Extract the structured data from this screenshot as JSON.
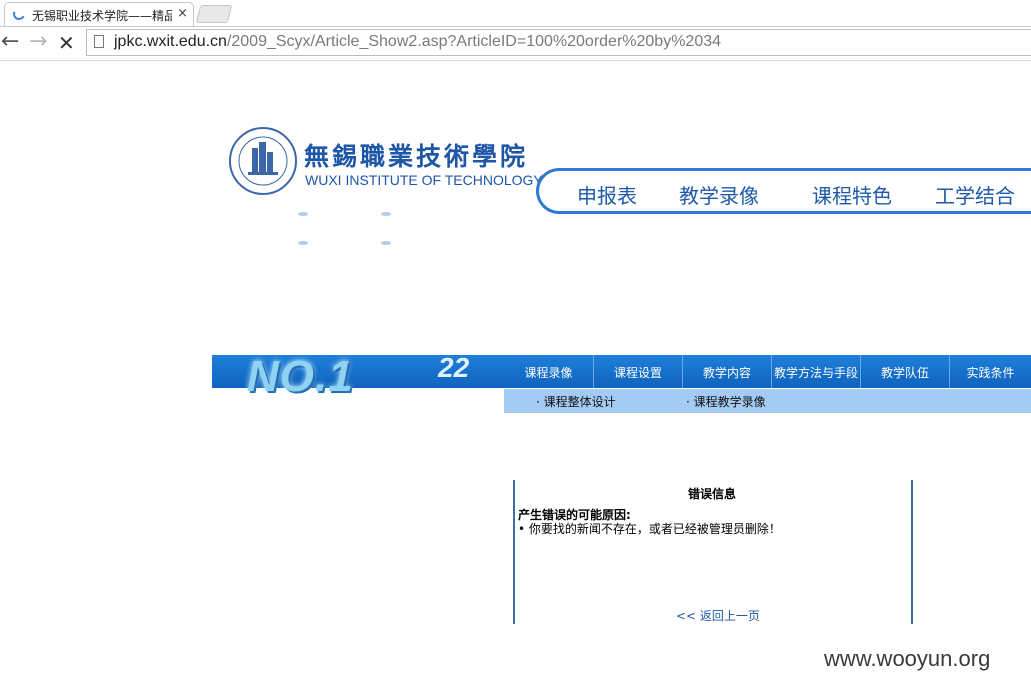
{
  "browser": {
    "tab_title": "无锡职业技术学院——精品",
    "tab_close": "×",
    "url_host": "jpkc.wxit.edu.cn",
    "url_path": "/2009_Scyx/Article_Show2.asp?ArticleID=100%20order%20by%2034",
    "back_icon": "←",
    "forward_icon": "→",
    "stop_icon": "✕"
  },
  "header": {
    "logo_cn": "無錫職業技術學院",
    "logo_en": "WUXI INSTITUTE OF TECHNOLOGY",
    "nav": [
      "申报表",
      "教学录像",
      "课程特色",
      "工学结合"
    ]
  },
  "banner": {
    "badge": "NO.1",
    "deco": "22",
    "menu": [
      "课程录像",
      "课程设置",
      "教学内容",
      "教学方法与手段",
      "教学队伍",
      "实践条件"
    ],
    "submenu": [
      "· 课程整体设计",
      "· 课程教学录像"
    ]
  },
  "error": {
    "title": "错误信息",
    "cause_label": "产生错误的可能原因:",
    "item": "• 你要找的新闻不存在，或者已经被管理员删除！",
    "back_link": "<< 返回上一页"
  },
  "watermark": "www.wooyun.org",
  "colors": {
    "brand_blue": "#1f57a8",
    "band_blue": "#1f7fdb",
    "subband_blue": "#a3cbf3"
  }
}
